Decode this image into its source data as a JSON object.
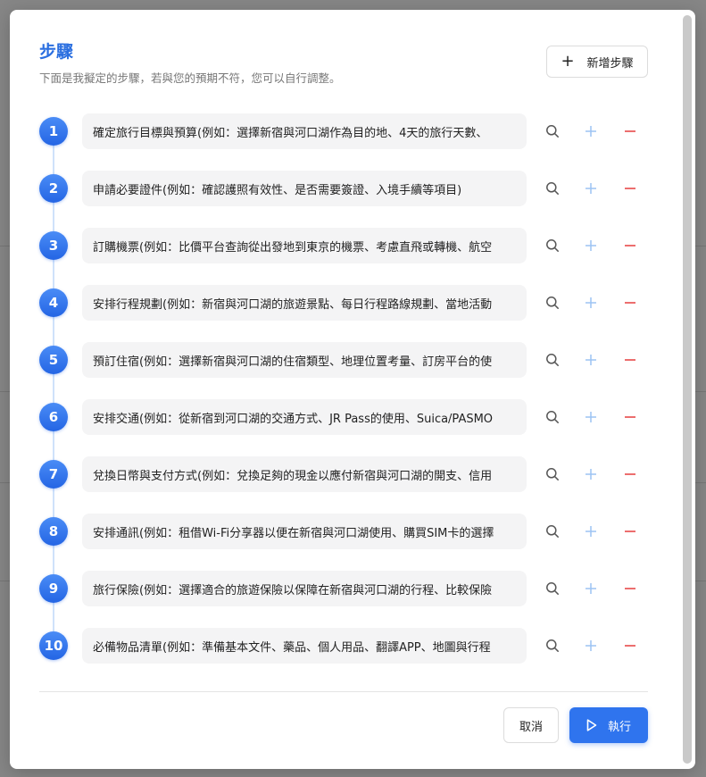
{
  "dialog": {
    "title": "步驟",
    "subtitle": "下面是我擬定的步驟，若與您的預期不符，您可以自行調整。",
    "add_step_label": "新增步驟",
    "cancel_label": "取消",
    "run_label": "執行"
  },
  "steps": [
    {
      "num": "1",
      "text": "確定旅行目標與預算(例如：選擇新宿與河口湖作為目的地、4天的旅行天數、"
    },
    {
      "num": "2",
      "text": "申請必要證件(例如：確認護照有效性、是否需要簽證、入境手續等項目)"
    },
    {
      "num": "3",
      "text": "訂購機票(例如：比價平台查詢從出發地到東京的機票、考慮直飛或轉機、航空"
    },
    {
      "num": "4",
      "text": "安排行程規劃(例如：新宿與河口湖的旅遊景點、每日行程路線規劃、當地活動"
    },
    {
      "num": "5",
      "text": "預訂住宿(例如：選擇新宿與河口湖的住宿類型、地理位置考量、訂房平台的使"
    },
    {
      "num": "6",
      "text": "安排交通(例如：從新宿到河口湖的交通方式、JR Pass的使用、Suica/PASMO"
    },
    {
      "num": "7",
      "text": "兌換日幣與支付方式(例如：兌換足夠的現金以應付新宿與河口湖的開支、信用"
    },
    {
      "num": "8",
      "text": "安排通訊(例如：租借Wi-Fi分享器以便在新宿與河口湖使用、購買SIM卡的選擇"
    },
    {
      "num": "9",
      "text": "旅行保險(例如：選擇適合的旅遊保險以保障在新宿與河口湖的行程、比較保險"
    },
    {
      "num": "10",
      "text": "必備物品清單(例如：準備基本文件、藥品、個人用品、翻譯APP、地圖與行程"
    }
  ],
  "icons": {
    "search": "search-icon",
    "add": "plus-icon",
    "remove": "minus-icon",
    "play": "play-icon"
  },
  "colors": {
    "accent": "#2f74ee",
    "title": "#2b6fe0",
    "remove": "#e84a4a",
    "add": "#9cc3f3"
  }
}
